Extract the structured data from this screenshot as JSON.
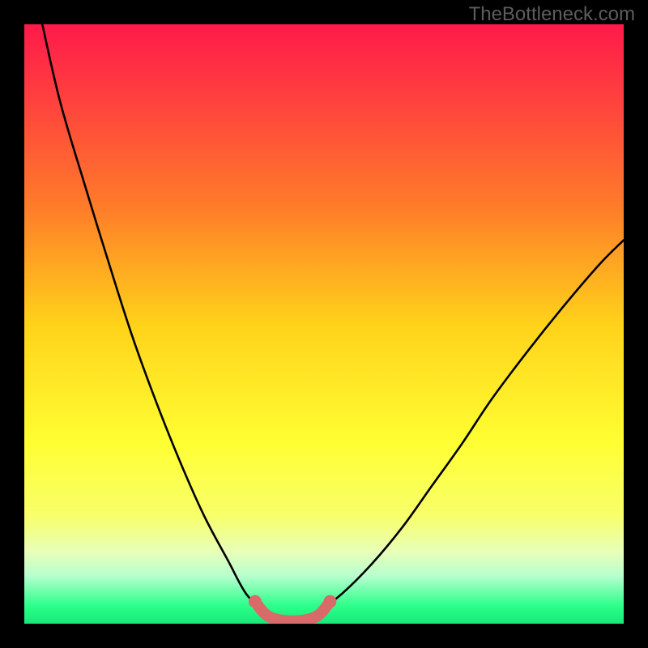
{
  "watermark": "TheBottleneck.com",
  "chart_data": {
    "type": "line",
    "title": "",
    "xlabel": "",
    "ylabel": "",
    "xlim": [
      0,
      100
    ],
    "ylim": [
      0,
      100
    ],
    "gradient_stops": [
      {
        "offset": 0.0,
        "color": "#ff1a4a"
      },
      {
        "offset": 0.12,
        "color": "#ff3f3f"
      },
      {
        "offset": 0.3,
        "color": "#ff7a2a"
      },
      {
        "offset": 0.5,
        "color": "#ffd21a"
      },
      {
        "offset": 0.7,
        "color": "#ffff33"
      },
      {
        "offset": 0.82,
        "color": "#f8ff6a"
      },
      {
        "offset": 0.88,
        "color": "#e8ffb8"
      },
      {
        "offset": 0.92,
        "color": "#b8ffcf"
      },
      {
        "offset": 0.97,
        "color": "#2cff8a"
      },
      {
        "offset": 1.0,
        "color": "#18e878"
      }
    ],
    "series": [
      {
        "name": "left-curve",
        "x": [
          3,
          6,
          10,
          14,
          18,
          22,
          26,
          30,
          34,
          37,
          40
        ],
        "y": [
          100,
          87,
          73.5,
          60.5,
          48,
          37,
          27,
          18,
          10.5,
          5,
          2
        ]
      },
      {
        "name": "right-curve",
        "x": [
          49,
          53,
          58,
          63,
          68,
          73,
          78,
          84,
          90,
          96,
          100
        ],
        "y": [
          2,
          5,
          10,
          16,
          23,
          30,
          37.5,
          45.5,
          53,
          60,
          64
        ]
      }
    ],
    "valley_band": {
      "name": "optimal-zone",
      "color": "#d86a6a",
      "points": [
        {
          "x": 38.5,
          "y": 3.7
        },
        {
          "x": 40.0,
          "y": 1.8
        },
        {
          "x": 41.5,
          "y": 0.9
        },
        {
          "x": 43.5,
          "y": 0.5
        },
        {
          "x": 46.0,
          "y": 0.5
        },
        {
          "x": 48.0,
          "y": 0.9
        },
        {
          "x": 49.5,
          "y": 1.8
        },
        {
          "x": 51.0,
          "y": 3.7
        }
      ]
    }
  }
}
